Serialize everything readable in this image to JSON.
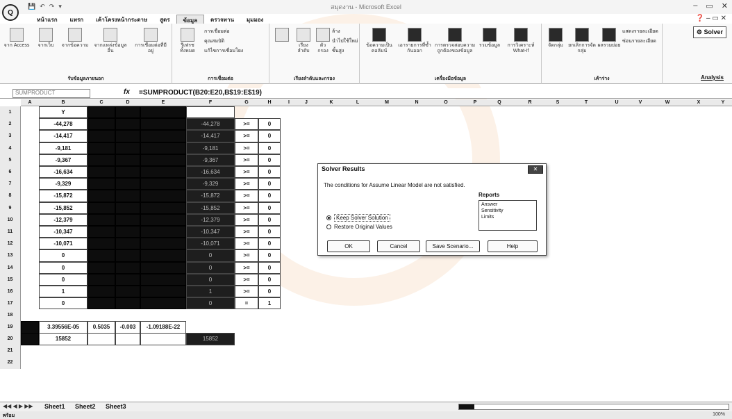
{
  "title_bar": {
    "office_button": "Q",
    "window_title": "สมุดงาน - Microsoft Excel",
    "qat": [
      "💾",
      "↶",
      "↷",
      "▾"
    ],
    "controls": [
      "–",
      "▭",
      "✕"
    ]
  },
  "ribbon_tabs": [
    "หน้าแรก",
    "แทรก",
    "เค้าโครงหน้ากระดาษ",
    "สูตร",
    "ข้อมูล",
    "ตรวจทาน",
    "มุมมอง"
  ],
  "active_tab": "ข้อมูล",
  "ribbon": {
    "solver_button": "Solver",
    "analysis_label": "Analysis",
    "groups": {
      "external": {
        "label": "รับข้อมูลภายนอก",
        "buttons": [
          "จาก Access",
          "จากเว็บ",
          "จากข้อความ",
          "จากแหล่งข้อมูลอื่น",
          "การเชื่อมต่อที่มีอยู่"
        ]
      },
      "connections": {
        "label": "การเชื่อมต่อ",
        "items": [
          "การเชื่อมต่อ",
          "คุณสมบัติ",
          "แก้ไขการเชื่อมโยง"
        ],
        "refresh": "รีเฟรชทั้งหมด"
      },
      "sort": {
        "label": "เรียงลำดับและกรอง",
        "sort_label": "เรียงลำดับ",
        "filter_label": "ตัวกรอง",
        "options": [
          "ล้าง",
          "นำไปใช้ใหม่",
          "ขั้นสูง"
        ]
      },
      "tools": {
        "label": "เครื่องมือข้อมูล",
        "buttons": [
          "ข้อความเป็นคอลัมน์",
          "เอารายการที่ซ้ำกันออก",
          "การตรวจสอบความถูกต้องของข้อมูล",
          "รวมข้อมูล",
          "การวิเคราะห์ What-If"
        ]
      },
      "outline": {
        "label": "เค้าร่าง",
        "buttons": [
          "จัดกลุ่ม",
          "ยกเลิกการจัดกลุ่ม",
          "ผลรวมย่อย"
        ],
        "options": [
          "แสดงรายละเอียด",
          "ซ่อนรายละเอียด"
        ]
      }
    }
  },
  "formula_bar": {
    "name_box": "SUMPRODUCT",
    "fx": "fx",
    "formula": "=SUMPRODUCT(B20:E20,B$19:E$19)"
  },
  "columns": [
    "A",
    "B",
    "C",
    "D",
    "E",
    "F",
    "G",
    "H",
    "I",
    "J",
    "K",
    "L",
    "M",
    "N",
    "O",
    "P",
    "Q",
    "R",
    "S",
    "T",
    "U",
    "V",
    "W",
    "X",
    "Y"
  ],
  "rows": [
    "1",
    "2",
    "3",
    "4",
    "5",
    "6",
    "7",
    "8",
    "9",
    "10",
    "11",
    "12",
    "13",
    "14",
    "15",
    "16",
    "17",
    "18",
    "19",
    "20",
    "21",
    "22"
  ],
  "sheet": {
    "header_b": "Y",
    "b_values": [
      "-44,278",
      "-14,417",
      "-9,181",
      "-9,367",
      "-16,634",
      "-9,329",
      "-15,872",
      "-15,852",
      "-12,379",
      "-10,347",
      "-10,071",
      "0",
      "0",
      "0",
      "1",
      "0"
    ],
    "f_values": [
      "-44,278",
      "-14,417",
      "-9,181",
      "-9,367",
      "-16,634",
      "-9,329",
      "-15,872",
      "-15,852",
      "-12,379",
      "-10,347",
      "-10,071",
      "0",
      "0",
      "0",
      "1",
      "0"
    ],
    "g_values": [
      ">=",
      ">=",
      ">=",
      ">=",
      ">=",
      ">=",
      ">=",
      ">=",
      ">=",
      ">=",
      ">=",
      ">=",
      ">=",
      ">=",
      ">=",
      "="
    ],
    "h_values": [
      "0",
      "0",
      "0",
      "0",
      "0",
      "0",
      "0",
      "0",
      "0",
      "0",
      "0",
      "0",
      "0",
      "0",
      "0",
      "1"
    ],
    "row19": [
      "3.39556E-05",
      "0.5035",
      "-0.003",
      "-1.09188E-22"
    ],
    "row20_b": "15852",
    "row20_f": "15852"
  },
  "dialog": {
    "title": "Solver Results",
    "close": "✕",
    "message": "The conditions for Assume Linear Model are not satisfied.",
    "reports_label": "Reports",
    "reports": [
      "Answer",
      "Sensitivity",
      "Limits"
    ],
    "keep_option": "Keep Solver Solution",
    "restore_option": "Restore Original Values",
    "buttons": {
      "ok": "OK",
      "cancel": "Cancel",
      "save": "Save Scenario...",
      "help": "Help"
    }
  },
  "sheet_tabs": [
    "Sheet1",
    "Sheet2",
    "Sheet3"
  ],
  "status": {
    "left": "พร้อม",
    "zoom": "100%"
  }
}
